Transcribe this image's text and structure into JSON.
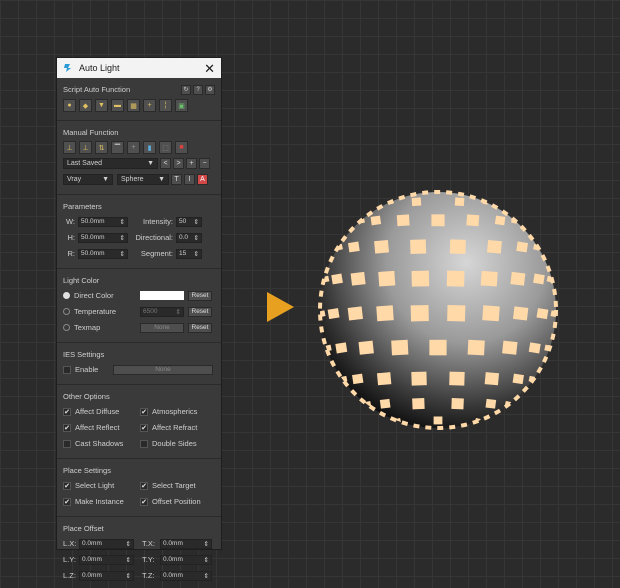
{
  "window": {
    "title": "Auto Light",
    "close_glyph": "✕"
  },
  "script_auto": {
    "title": "Script Auto Function",
    "header_buttons": [
      "↻",
      "?",
      "⚙"
    ],
    "buttons": [
      "bulb-icon",
      "bulb-target-icon",
      "bulb-down-icon",
      "bulb-spot-icon",
      "grid-icon",
      "plus-light-icon",
      "split-icon",
      "image-icon"
    ]
  },
  "manual": {
    "title": "Manual Function",
    "buttons": [
      "align-icon",
      "align-target-icon",
      "swap-icon",
      "down-light-icon",
      "crosshair-icon",
      "split-blue-icon",
      "select-icon",
      "delete-red-icon"
    ],
    "preset": "Last Saved",
    "preset_buttons": [
      "<",
      ">",
      "+",
      "−"
    ],
    "renderer": "Vray",
    "shape": "Sphere",
    "shape_buttons": [
      "T",
      "I",
      "A"
    ]
  },
  "parameters": {
    "title": "Parameters",
    "w_label": "W:",
    "w_value": "50.0mm",
    "h_label": "H:",
    "h_value": "50.0mm",
    "r_label": "R:",
    "r_value": "50.0mm",
    "intensity_label": "Intensity:",
    "intensity_value": "50",
    "directional_label": "Directional:",
    "directional_value": "0.0",
    "segment_label": "Segment:",
    "segment_value": "15"
  },
  "light_color": {
    "title": "Light Color",
    "direct_label": "Direct Color",
    "direct_color": "#ffffff",
    "temperature_label": "Temperature",
    "temperature_value": "6500",
    "texmap_label": "Texmap",
    "texmap_value": "None",
    "reset_label": "Reset"
  },
  "ies": {
    "title": "IES Settings",
    "enable_label": "Enable",
    "file_value": "None"
  },
  "other": {
    "title": "Other Options",
    "affect_diffuse": "Affect Diffuse",
    "atmospherics": "Atmospherics",
    "affect_reflect": "Affect Reflect",
    "affect_refract": "Affect Refract",
    "cast_shadows": "Cast Shadows",
    "double_sides": "Double Sides"
  },
  "place": {
    "title": "Place Settings",
    "select_light": "Select Light",
    "select_target": "Select Target",
    "make_instance": "Make Instance",
    "offset_position": "Offset Position"
  },
  "offset": {
    "title": "Place Offset",
    "lx_label": "L.X:",
    "lx_value": "0.0mm",
    "tx_label": "T.X:",
    "tx_value": "0.0mm",
    "ly_label": "L.Y:",
    "ly_value": "0.0mm",
    "ty_label": "T.Y:",
    "ty_value": "0.0mm",
    "lz_label": "L.Z:",
    "lz_value": "0.0mm",
    "tz_label": "T.Z:",
    "tz_value": "0.0mm"
  },
  "spinner_glyph": "⇕",
  "dropdown_glyph": "▼",
  "check_glyph": "✔",
  "colors": {
    "accent_arrow": "#e8a020",
    "light_patch": "#ffd9a8",
    "panel_bg": "#3a3a3a"
  }
}
